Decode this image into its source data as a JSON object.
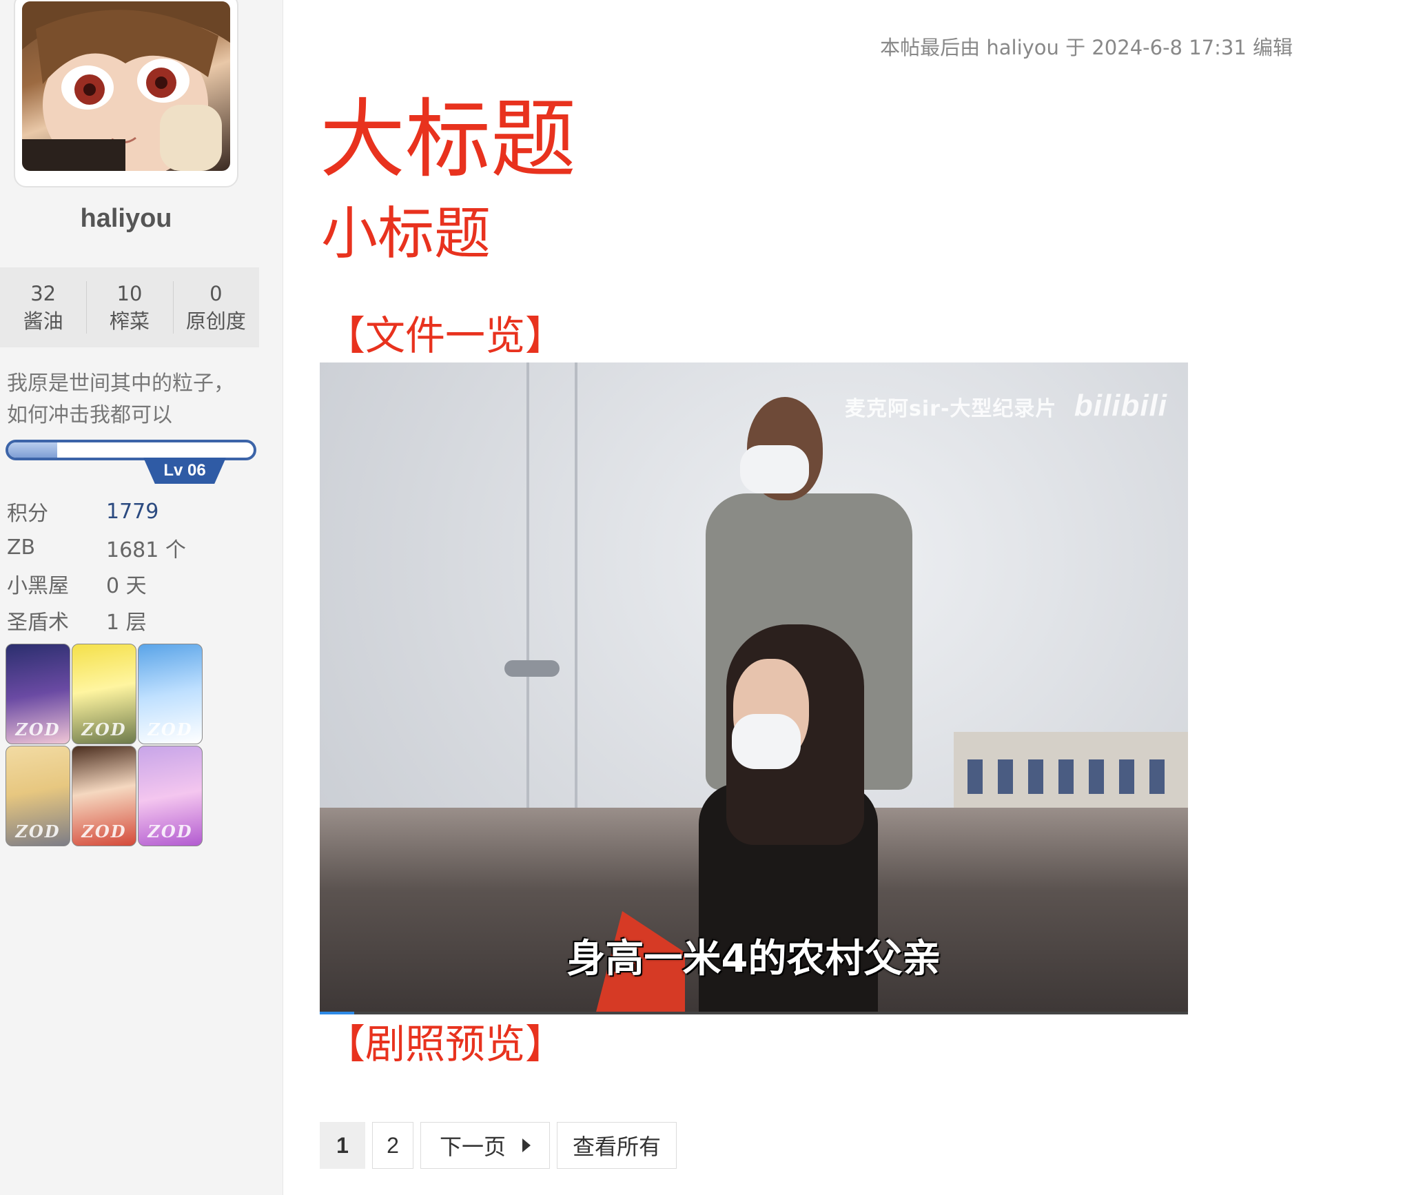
{
  "author": {
    "username": "haliyou",
    "stats": [
      {
        "value": "32",
        "label": "酱油"
      },
      {
        "value": "10",
        "label": "榨菜"
      },
      {
        "value": "0",
        "label": "原创度"
      }
    ],
    "signature_line1": "我原是世间其中的粒子，",
    "signature_line2": "如何冲击我都可以",
    "level_label": "Lv 06",
    "level_progress": 0.2,
    "info": [
      {
        "label": "积分",
        "value": "1779"
      },
      {
        "label": "ZB",
        "value": "1681 个"
      },
      {
        "label": "小黑屋",
        "value": "0 天"
      },
      {
        "label": "圣盾术",
        "value": "1 层"
      }
    ],
    "medal_count": 6
  },
  "post": {
    "edit_note": "本帖最后由 haliyou 于 2024-6-8 17:31 编辑",
    "big_title": "大标题",
    "sub_title": "小标题",
    "section_files": "【文件一览】",
    "section_preview": "【剧照预览】",
    "video": {
      "watermark_text": "麦克阿sir-大型纪录片",
      "watermark_logo": "bilibili",
      "subtitle": "身高一米4的农村父亲",
      "progress": 0.04
    }
  },
  "pagination": {
    "current": "1",
    "page2": "2",
    "next_label": "下一页",
    "view_all_label": "查看所有"
  },
  "colors": {
    "title_red": "#e8321e",
    "level_blue": "#2f5ba5",
    "link_blue": "#2b4a80"
  }
}
